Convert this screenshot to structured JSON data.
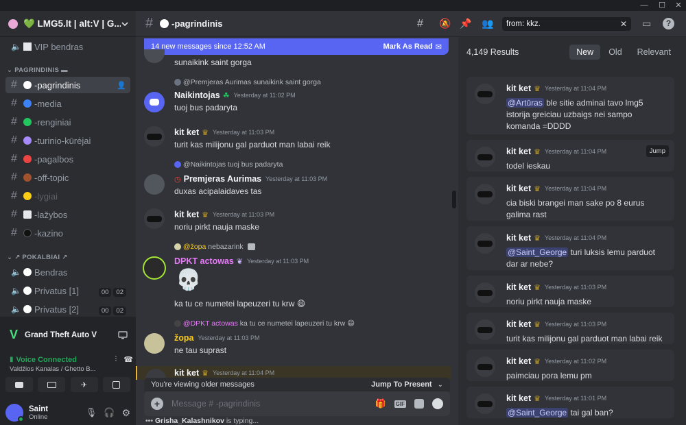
{
  "server": {
    "name": "💚 LMG5.lt | alt:V | G..."
  },
  "channels": {
    "vip": "VIP bendras",
    "cat_main": "PAGRINDINIS",
    "items": [
      {
        "label": "-pagrindinis",
        "color": "#ffffff"
      },
      {
        "label": "-media",
        "color": "#3b82f6"
      },
      {
        "label": "-renginiai",
        "color": "#22c55e"
      },
      {
        "label": "-turinio-kūrėjai",
        "color": "#a78bfa"
      },
      {
        "label": "-pagalbos",
        "color": "#ef4444"
      },
      {
        "label": "-off-topic",
        "color": "#a0522d"
      },
      {
        "label": "-lygiai",
        "color": "#facc15"
      },
      {
        "label": "-lažybos",
        "color": "#e5e7eb"
      },
      {
        "label": "-kazino",
        "color": "#111111"
      }
    ],
    "cat_voice": "POKALBIAI",
    "voice": [
      {
        "label": "Bendras"
      },
      {
        "label": "Privatus [1]",
        "a": "00",
        "b": "02"
      },
      {
        "label": "Privatus [2]",
        "a": "00",
        "b": "02"
      }
    ]
  },
  "activity": {
    "game": "Grand Theft Auto V",
    "voice_status": "Voice Connected",
    "voice_channel": "Valdžios Kanalas / Ghetto B..."
  },
  "user": {
    "name": "Saint",
    "status": "Online"
  },
  "header": {
    "channel": "-pagrindinis",
    "search_value": "from: kkz."
  },
  "new_bar": {
    "text": "14 new messages since 12:52 AM",
    "action": "Mark As Read"
  },
  "messages": [
    {
      "body": "sunaikink saint gorga"
    },
    {
      "reply_to": "@Premjeras Aurimas",
      "reply_text": "sunaikink saint gorga",
      "author": "Naikintojas",
      "author_color": "#f2f3f5",
      "ts": "Yesterday at 11:02 PM",
      "body": "tuoj bus padaryta"
    },
    {
      "author": "kit ket",
      "author_color": "#f2f3f5",
      "ts": "Yesterday at 11:03 PM",
      "body": "turit kas milijonu gal parduot man labai reik"
    },
    {
      "reply_to": "@Naikintojas",
      "reply_text": "tuoj bus padaryta",
      "author": "Premjeras Aurimas",
      "author_color": "#f2f3f5",
      "ts": "Yesterday at 11:03 PM",
      "body": "duxas acipalaidaves tas"
    },
    {
      "author": "kit ket",
      "author_color": "#f2f3f5",
      "ts": "Yesterday at 11:03 PM",
      "body": "noriu pirkt nauja maske"
    },
    {
      "reply_to": "@žopa",
      "reply_text": "nebazarink",
      "author": "DPKT actowas",
      "author_color": "#e879f9",
      "ts": "Yesterday at 11:03 PM",
      "body": "ka tu ce numetei lapeuzeri tu krw 😄"
    },
    {
      "reply_to": "@DPKT actowas",
      "reply_text": "ka tu ce numetei lapeuzeri tu krw 😄",
      "author": "žopa",
      "author_color": "#facc15",
      "ts": "Yesterday at 11:03 PM",
      "body": "ne tau suprast"
    },
    {
      "author": "kit ket",
      "author_color": "#f2f3f5",
      "ts": "Yesterday at 11:04 PM",
      "body": ""
    }
  ],
  "older_bar": {
    "text": "You're viewing older messages",
    "action": "Jump To Present"
  },
  "composer": {
    "placeholder": "Message #  -pagrindinis"
  },
  "typing": {
    "name": "Grisha_Kalashnikov",
    "text": " is typing..."
  },
  "results": {
    "count": "4,149 Results",
    "tabs": [
      "New",
      "Old",
      "Relevant"
    ],
    "jump": "Jump",
    "items": [
      {
        "author": "kit ket",
        "ts": "Yesterday at 11:04 PM",
        "mention": "@Artūras",
        "text": " ble sitie adminai tavo lmg5 istorija greiciau uzbaigs nei sampo komanda =DDDD"
      },
      {
        "author": "kit ket",
        "ts": "Yesterday at 11:04 PM",
        "mention": "",
        "text": "todel ieskau"
      },
      {
        "author": "kit ket",
        "ts": "Yesterday at 11:04 PM",
        "mention": "",
        "text": "cia biski brangei man sake po 8 eurus galima rast"
      },
      {
        "author": "kit ket",
        "ts": "Yesterday at 11:04 PM",
        "mention": "@Saint_George",
        "text": " turi luksis lemu parduot dar ar nebe?"
      },
      {
        "author": "kit ket",
        "ts": "Yesterday at 11:03 PM",
        "mention": "",
        "text": "noriu pirkt nauja maske"
      },
      {
        "author": "kit ket",
        "ts": "Yesterday at 11:03 PM",
        "mention": "",
        "text": "turit kas milijonu gal parduot man labai reik"
      },
      {
        "author": "kit ket",
        "ts": "Yesterday at 11:02 PM",
        "mention": "",
        "text": "paimciau pora lemu pm"
      },
      {
        "author": "kit ket",
        "ts": "Yesterday at 11:01 PM",
        "mention": "@Saint_George",
        "text": " tai gal ban?"
      }
    ]
  },
  "colors": {
    "accent": "#5865f2",
    "online": "#23a55a",
    "voice": "#23a55a"
  }
}
